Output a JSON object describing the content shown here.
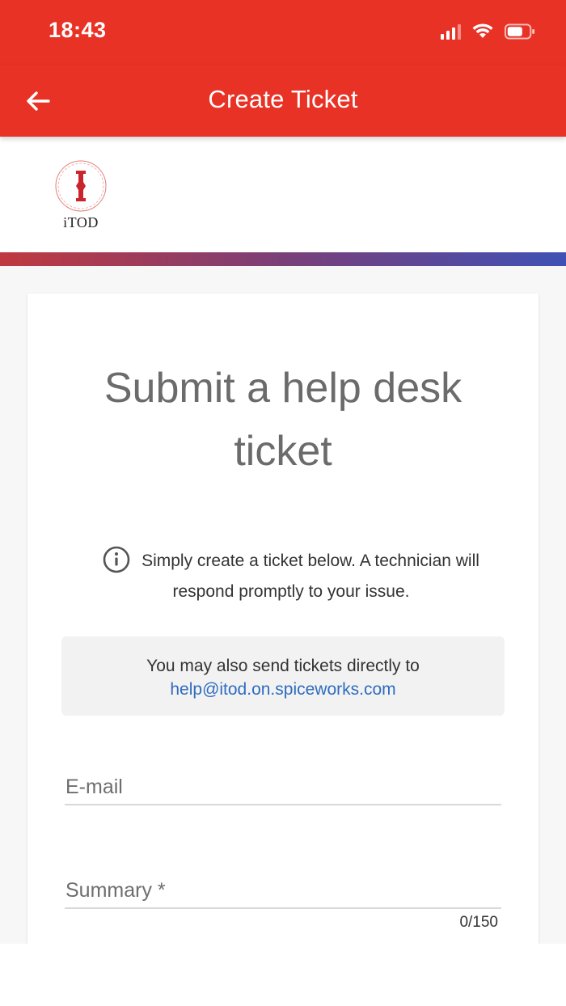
{
  "status_bar": {
    "time": "18:43",
    "icons": [
      "cellular-signal-icon",
      "wifi-icon",
      "battery-icon"
    ]
  },
  "app_bar": {
    "back_icon": "arrow-left-icon",
    "title": "Create Ticket"
  },
  "logo": {
    "text": "iTOD",
    "icon": "itod-logo-icon"
  },
  "form": {
    "title": "Submit a help desk ticket",
    "info_icon": "info-circle-icon",
    "info_text": "Simply create a ticket below. A technician will respond promptly to your issue.",
    "notice_text": "You may also send tickets directly to",
    "notice_email": "help@itod.on.spiceworks.com",
    "email_label": "E-mail",
    "summary_label": "Summary *",
    "summary_counter": "0/150"
  },
  "colors": {
    "brand_red": "#e93226",
    "link_blue": "#2f6cc0",
    "gradient_start": "#c0393f",
    "gradient_end": "#3f51b5"
  }
}
